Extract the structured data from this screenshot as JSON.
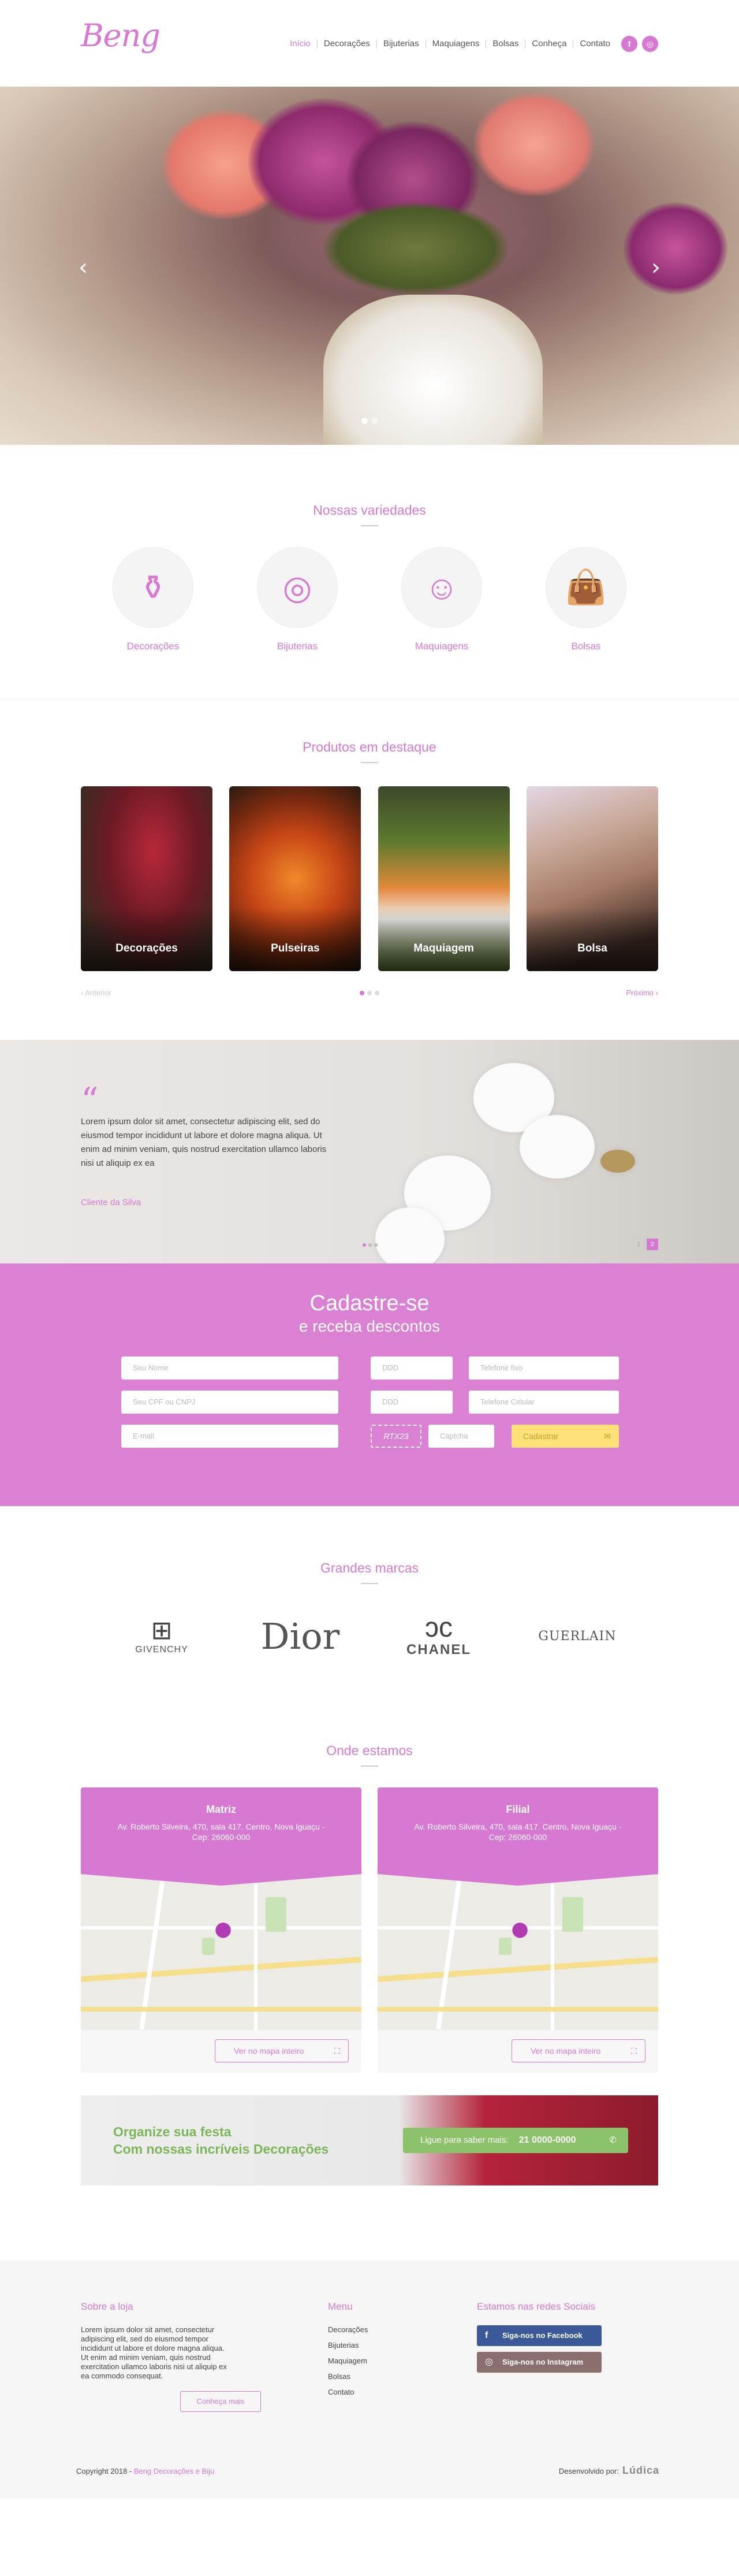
{
  "brand": {
    "logo_text": "Beng"
  },
  "nav": {
    "items": [
      "Início",
      "Decorações",
      "Bijuterias",
      "Maquiagens",
      "Bolsas",
      "Conheça",
      "Contato"
    ]
  },
  "social_header": [
    "f",
    "◎"
  ],
  "hero": {
    "prev": "‹",
    "next": "›"
  },
  "variedades": {
    "title": "Nossas variedades",
    "items": [
      {
        "label": "Decorações",
        "icon": "vase-icon"
      },
      {
        "label": "Bijuterias",
        "icon": "necklace-icon"
      },
      {
        "label": "Maquiagens",
        "icon": "woman-face-icon"
      },
      {
        "label": "Bolsas",
        "icon": "handbag-icon"
      }
    ]
  },
  "produtos": {
    "title": "Produtos em destaque",
    "items": [
      "Decorações",
      "Pulseiras",
      "Maquiagem",
      "Bolsa"
    ],
    "prev": "Anterior",
    "next": "Próximo"
  },
  "depoimento": {
    "quote_mark": "“",
    "text": "Lorem ipsum dolor sit amet, consectetur adipiscing elit, sed do eiusmod tempor incididunt ut labore et dolore magna aliqua. Ut enim ad minim veniam, quis nostrud exercitation ullamco laboris nisi ut aliquip ex ea",
    "author": "Cliente da Silva",
    "pages": [
      "1",
      "2"
    ]
  },
  "cadastro": {
    "title": "Cadastre-se",
    "subtitle": "e receba descontos",
    "fields": {
      "nome": "Seu Nome",
      "ddd1": "DDD",
      "tel_fixo": "Telefone fixo",
      "cpf": "Seu CPF ou CNPJ",
      "ddd2": "DDD",
      "tel_cel": "Telefone Celular",
      "email": "E-mail",
      "captcha_img": "RTX23",
      "captcha": "Captcha"
    },
    "submit": "Cadastrar",
    "submit_icon": "✉"
  },
  "marcas": {
    "title": "Grandes marcas",
    "items": [
      "GIVENCHY",
      "Dior",
      "CHANEL",
      "GUERLAIN"
    ]
  },
  "onde": {
    "title": "Onde estamos",
    "locations": [
      {
        "name": "Matriz",
        "address": "Av. Roberto Silveira, 470, sala 417. Centro, Nova Iguaçu - Cep: 26060-000",
        "button": "Ver no mapa inteiro"
      },
      {
        "name": "Filial",
        "address": "Av. Roberto Silveira, 470, sala 417. Centro, Nova Iguaçu - Cep: 26060-000",
        "button": "Ver no mapa inteiro"
      }
    ]
  },
  "banner": {
    "line1": "Organize sua festa",
    "line2": "Com nossas incríveis Decorações",
    "call_label": "Ligue para saber mais:",
    "phone": "21 0000-0000",
    "phone_icon": "✆"
  },
  "footer": {
    "about_title": "Sobre a loja",
    "about_text": "Lorem ipsum dolor sit amet, consectetur adipiscing elit, sed do eiusmod tempor incididunt ut labore et dolore magna aliqua. Ut enim ad minim veniam, quis nostrud exercitation ullamco laboris nisi ut aliquip ex ea commodo consequat.",
    "about_button": "Conheça mais",
    "menu_title": "Menu",
    "menu_items": [
      "Decorações",
      "Bijuterias",
      "Maquiagem",
      "Bolsas",
      "Contato"
    ],
    "social_title": "Estamos nas redes Sociais",
    "facebook": "Siga-nos no Facebook",
    "instagram": "Siga-nos no Instagram",
    "copyright_prefix": "Copyright 2018 - ",
    "copyright_name": "Beng Decorações e Biju",
    "dev_label": "Desenvolvido por:",
    "dev_name": "Lúdica"
  },
  "colors": {
    "accent": "#d779d3",
    "cadastro_bg": "#db81d4",
    "button_yellow": "#ffe079",
    "green": "#8bc26a"
  }
}
